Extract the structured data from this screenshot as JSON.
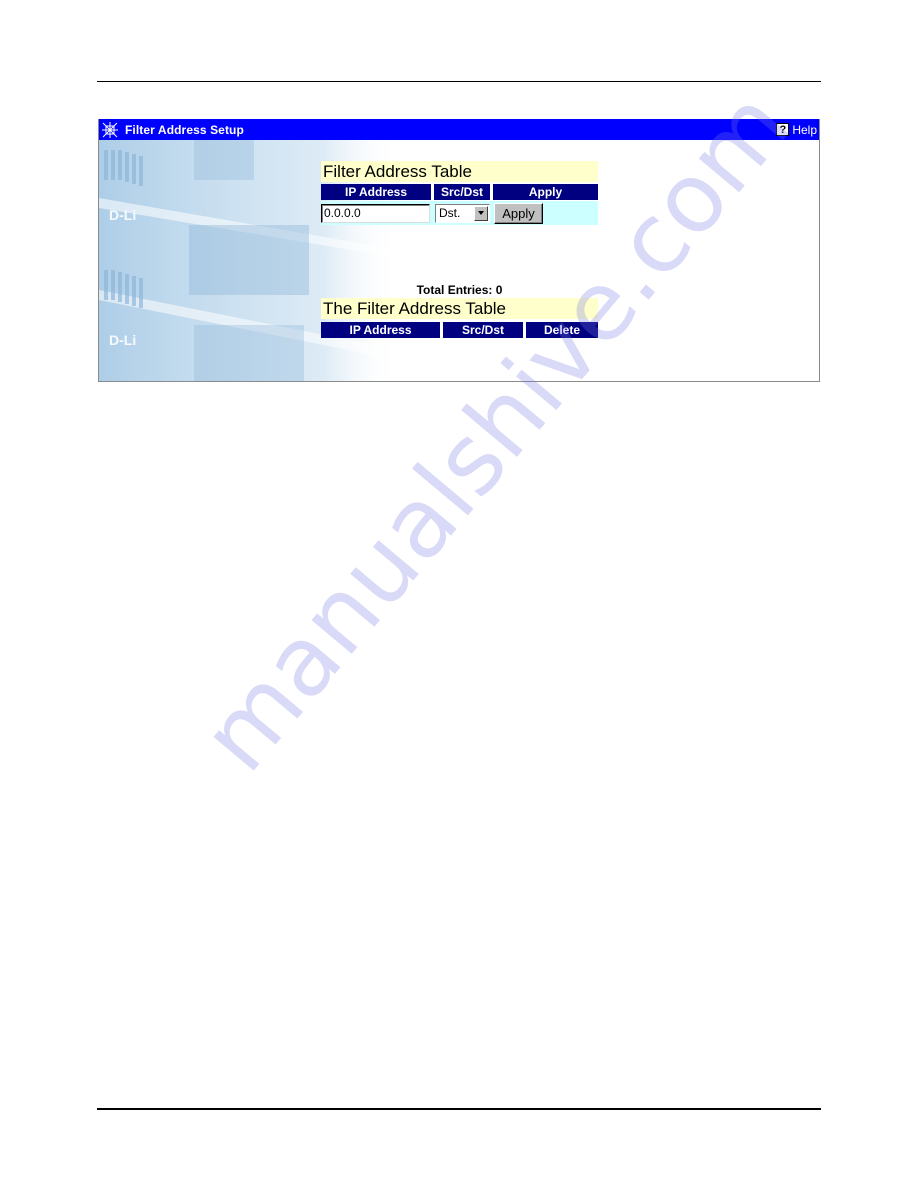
{
  "window": {
    "title": "Filter Address Setup",
    "help_label": "Help",
    "help_icon_glyph": "?",
    "app_icon": "network-web-icon",
    "titlebar_color": "#0000ff"
  },
  "entry_table": {
    "title": "Filter Address Table",
    "headers": [
      "IP Address",
      "Src/Dst",
      "Apply"
    ],
    "ip_value": "0.0.0.0",
    "src_dst_selected": "Dst.",
    "apply_label": "Apply"
  },
  "summary": {
    "total_entries_label": "Total Entries: 0"
  },
  "list_table": {
    "title": "The Filter Address Table",
    "headers": [
      "IP Address",
      "Src/Dst",
      "Delete"
    ],
    "rows": []
  },
  "colors": {
    "header_bg": "#000080",
    "title_bg": "#ffffcc",
    "input_row_bg": "#ccffff"
  },
  "watermark": "manualshive.com"
}
